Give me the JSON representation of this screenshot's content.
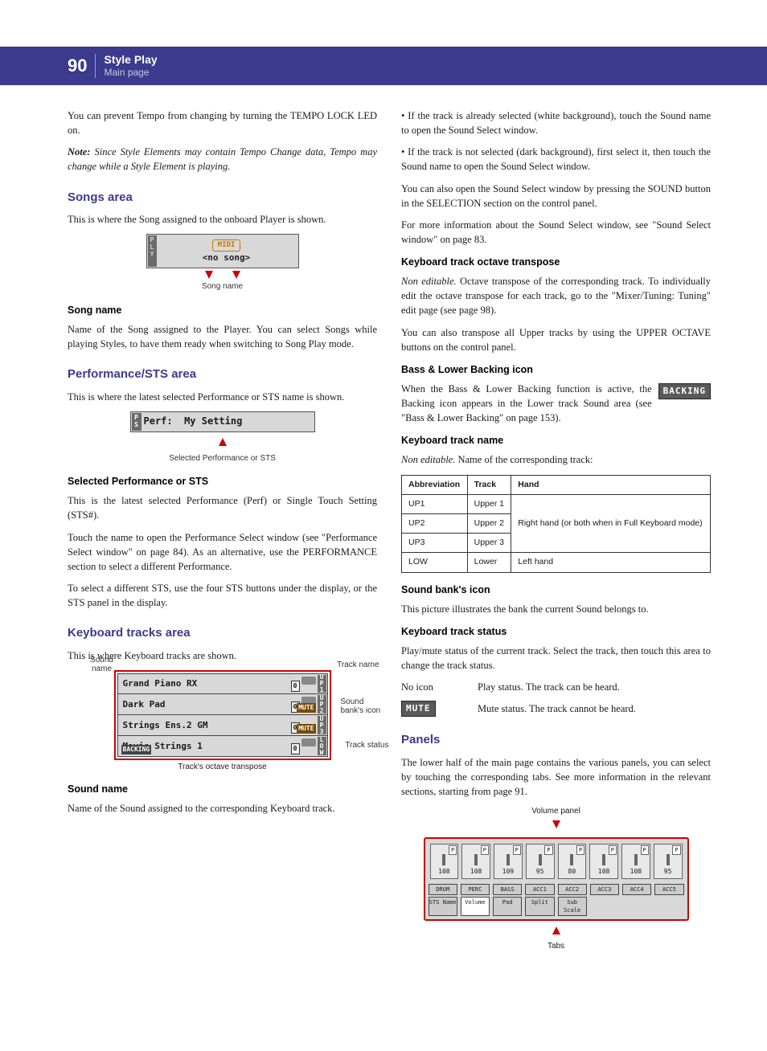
{
  "header": {
    "page": "90",
    "section": "Style Play",
    "sub": "Main page"
  },
  "left": {
    "p1": "You can prevent Tempo from changing by turning the TEMPO LOCK LED on.",
    "note_label": "Note:",
    "note": "Since Style Elements may contain Tempo Change data, Tempo may change while a Style Element is playing.",
    "songs_h": "Songs area",
    "songs_p": "This is where the Song assigned to the onboard Player is shown.",
    "songbox_midi": "MIDI",
    "songbox_nosong": "<no song>",
    "songbox_caption": "Song name",
    "songname_h": "Song name",
    "songname_p": "Name of the Song assigned to the Player. You can select Songs while playing Styles, to have them ready when switching to Song Play mode.",
    "perf_h": "Performance/STS area",
    "perf_p": "This is where the latest selected Performance or STS name is shown.",
    "perfbox_lbl": "Perf:",
    "perfbox_val": "My Setting",
    "perfbox_caption": "Selected Performance or STS",
    "selperf_h": "Selected Performance or STS",
    "selperf_p1": "This is the latest selected Performance (Perf) or Single Touch Setting (STS#).",
    "selperf_p2": "Touch the name to open the Performance Select window (see \"Performance Select window\" on page 84). As an alternative, use the PERFORMANCE section to select a different Performance.",
    "selperf_p3": "To select a different STS, use the four STS buttons under the display, or the STS panel in the display.",
    "kbtracks_h": "Keyboard tracks area",
    "kbtracks_p": "This is where Keyboard tracks are shown.",
    "kb_labels": {
      "sound_name": "Sound name",
      "track_name": "Track name",
      "bank_icon": "Sound bank's icon",
      "track_status": "Track status",
      "octave": "Track's octave transpose"
    },
    "kb_rows": [
      {
        "name": "Grand Piano RX",
        "side": "UP1",
        "oct": "0",
        "mute": false
      },
      {
        "name": "Dark Pad",
        "side": "UP2",
        "oct": "0",
        "mute": true
      },
      {
        "name": "Strings Ens.2 GM",
        "side": "UP3",
        "oct": "0",
        "mute": true
      },
      {
        "name": "Movie Strings 1",
        "side": "LOW",
        "oct": "0",
        "mute": false,
        "backing": true
      }
    ],
    "soundname_h": "Sound name",
    "soundname_p": "Name of the Sound assigned to the corresponding Keyboard track."
  },
  "right": {
    "b1": "If the track is already selected (white background), touch the Sound name to open the Sound Select window.",
    "b2": "If the track is not selected (dark background), first select it, then touch the Sound name to open the Sound Select window.",
    "p1": "You can also open the Sound Select window by pressing the SOUND button in the SELECTION section on the control panel.",
    "p2": "For more information about the Sound Select window, see \"Sound Select window\" on page 83.",
    "oct_h": "Keyboard track octave transpose",
    "oct_p1_lbl": "Non editable.",
    "oct_p1": "Octave transpose of the corresponding track. To individually edit the octave transpose for each track, go to the \"Mixer/Tuning: Tuning\" edit page (see page 98).",
    "oct_p2": "You can also transpose all Upper tracks by using the UPPER OCTAVE buttons on the control panel.",
    "backing_h": "Bass & Lower Backing icon",
    "backing_badge": "BACKING",
    "backing_p": "When the Bass & Lower Backing function is active, the Backing icon appears in the Lower track Sound area (see \"Bass & Lower Backing\" on page 153).",
    "kbname_h": "Keyboard track name",
    "kbname_lbl": "Non editable.",
    "kbname_p": "Name of the corresponding track:",
    "table": {
      "headers": [
        "Abbreviation",
        "Track",
        "Hand"
      ],
      "rows": [
        [
          "UP1",
          "Upper 1",
          "Right hand (or both when in Full Keyboard mode)"
        ],
        [
          "UP2",
          "Upper 2",
          ""
        ],
        [
          "UP3",
          "Upper 3",
          ""
        ],
        [
          "LOW",
          "Lower",
          "Left hand"
        ]
      ]
    },
    "bankicon_h": "Sound bank's icon",
    "bankicon_p": "This picture illustrates the bank the current Sound belongs to.",
    "status_h": "Keyboard track status",
    "status_p": "Play/mute status of the current track. Select the track, then touch this area to change the track status.",
    "status_noicon_lbl": "No icon",
    "status_noicon": "Play status. The track can be heard.",
    "status_mute_badge": "MUTE",
    "status_mute": "Mute status. The track cannot be heard.",
    "panels_h": "Panels",
    "panels_p": "The lower half of the main page contains the various panels, you can select by touching the corresponding tabs. See more information in the relevant sections, starting from page 91.",
    "vol_caption_top": "Volume panel",
    "vol_caption_bottom": "Tabs",
    "vol_sliders": [
      "108",
      "108",
      "109",
      "95",
      "80",
      "108",
      "108",
      "95"
    ],
    "vol_tracks": [
      "DRUM",
      "PERC",
      "BASS",
      "ACC1",
      "ACC2",
      "ACC3",
      "ACC4",
      "ACC5"
    ],
    "vol_tabs": [
      "STS Name",
      "Volume",
      "Pad",
      "Split",
      "Sub Scale"
    ]
  }
}
